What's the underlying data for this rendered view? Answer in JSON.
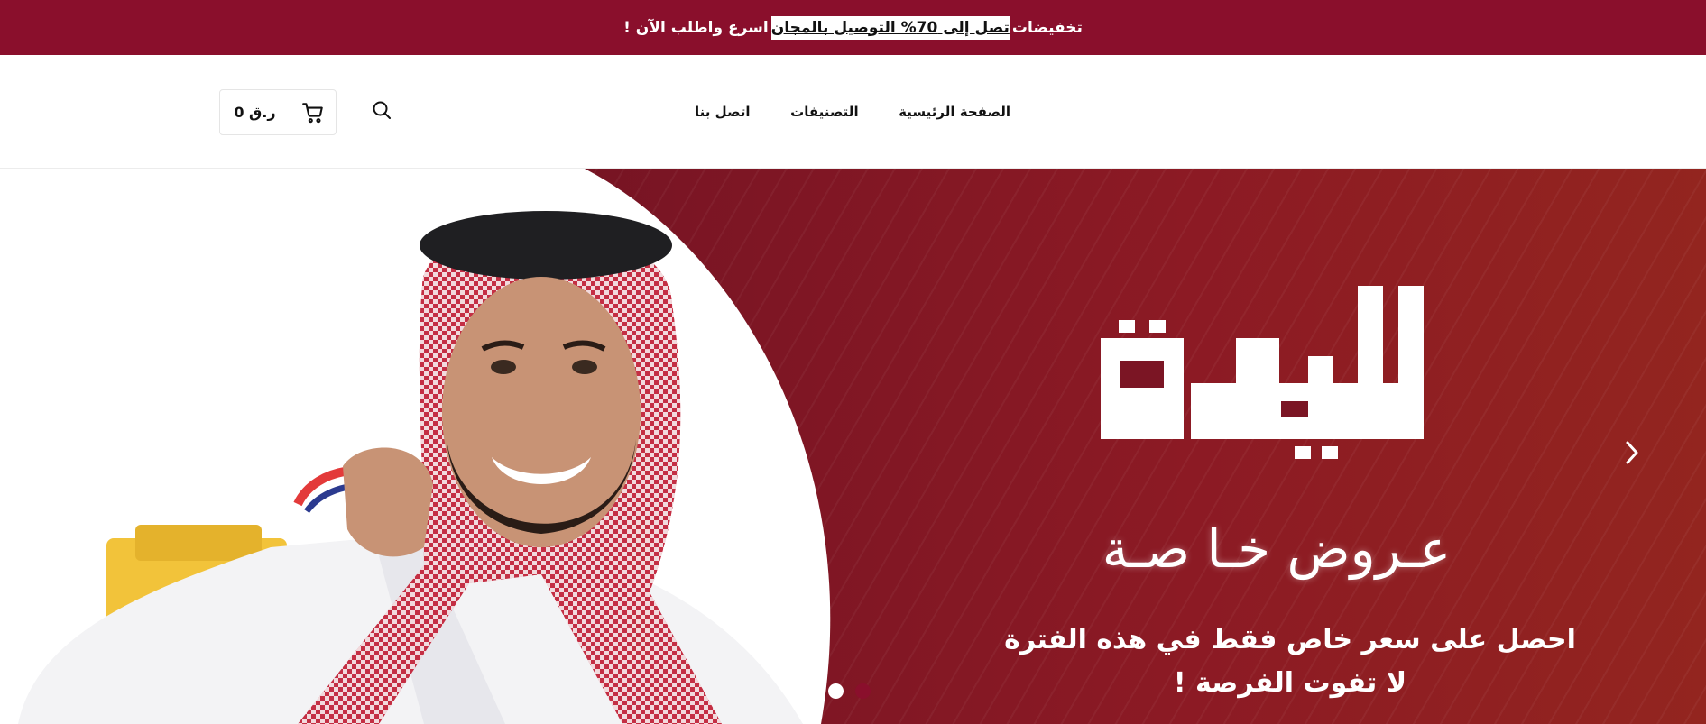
{
  "announcement": {
    "before": "تخفيضات",
    "highlight": "تصل إلى 70% التوصيل بالمجان",
    "after": "اسرع واطلب الآن !"
  },
  "nav": {
    "items": [
      {
        "label": "الصفحة الرئيسية"
      },
      {
        "label": "التصنيفات"
      },
      {
        "label": "اتصل بنا"
      }
    ]
  },
  "cart": {
    "total": "0 ر.ق"
  },
  "icons": {
    "search": "search-icon",
    "cart": "cart-icon",
    "next": "chevron-right-icon"
  },
  "hero": {
    "logo_text": "البركة",
    "script_title": "عـروض خـا صـة",
    "line1": "احصل على سعر خاص فقط في هذه الفترة",
    "line2": "لا تفوت الفرصة !",
    "slide_count": 2,
    "active_slide": 1
  },
  "colors": {
    "brand": "#8a0f2c",
    "hero_bg": "#7a1424",
    "dot_active": "#ffffff",
    "dot_inactive": "#8a0f2c"
  }
}
